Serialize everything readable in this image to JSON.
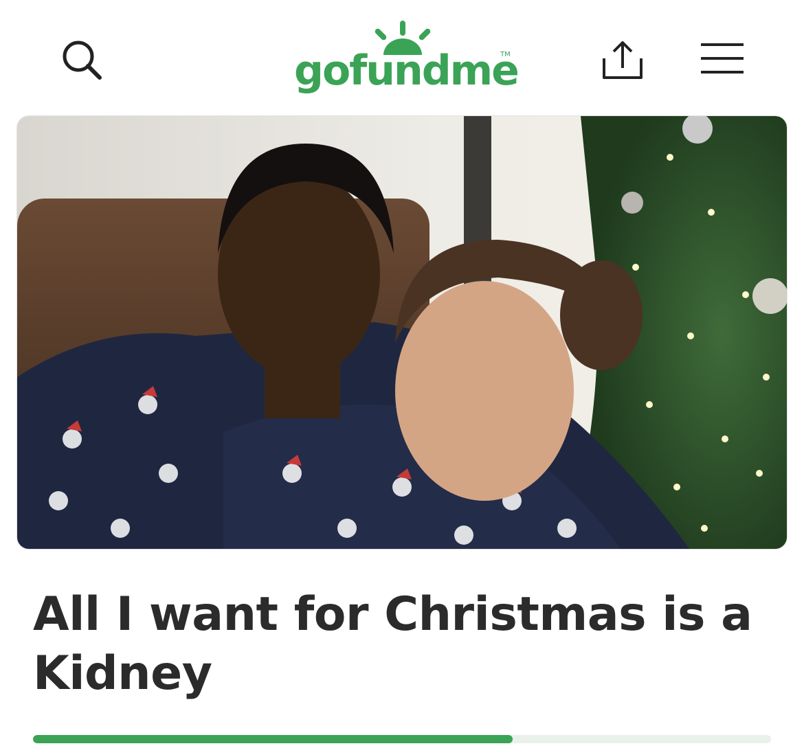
{
  "header": {
    "logo_text": "gofundme",
    "logo_tm": "TM",
    "search_icon": "search-icon",
    "share_icon": "share-icon",
    "menu_icon": "hamburger-menu-icon"
  },
  "campaign": {
    "title": "All I want for Christmas is a Kidney",
    "progress_fraction": 0.65
  },
  "colors": {
    "brand_green": "#3aa356",
    "title_text": "#2b2b2b",
    "progress_track": "#e9f1ea"
  }
}
